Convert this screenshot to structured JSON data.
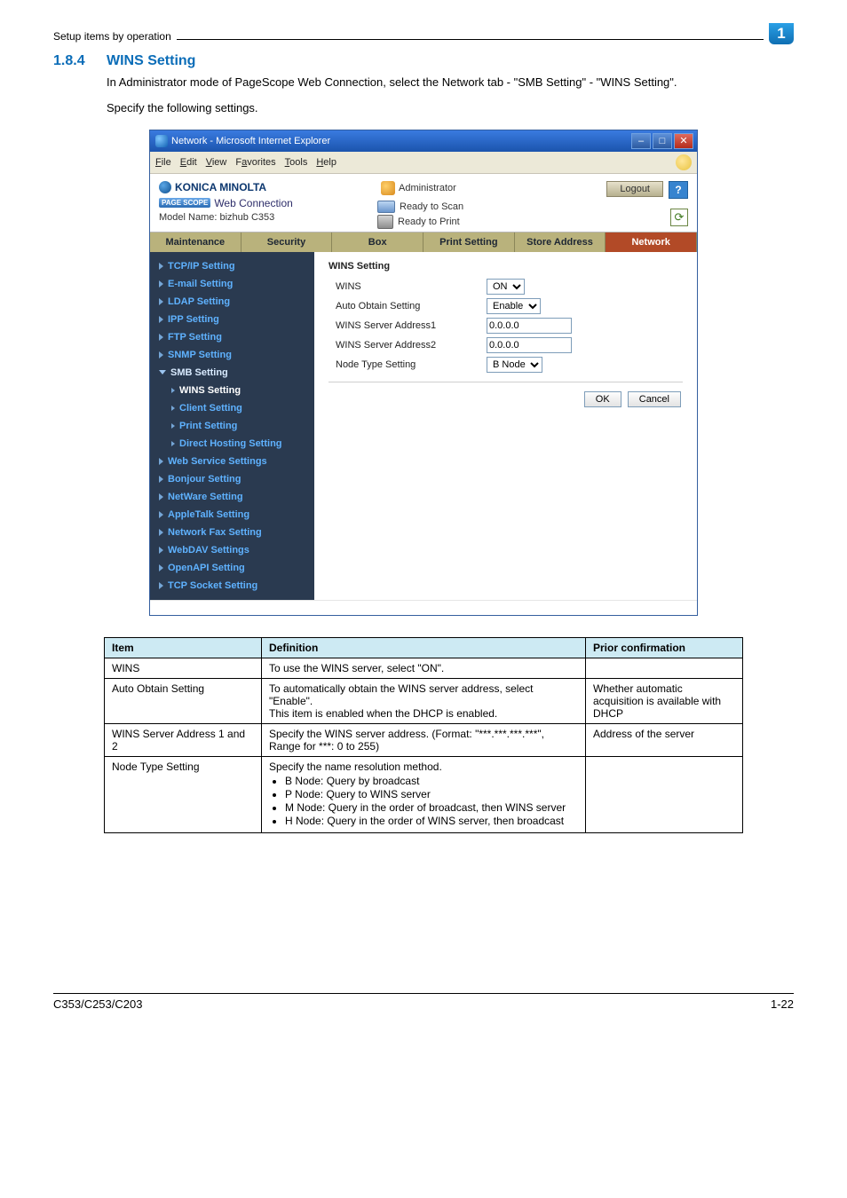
{
  "breadcrumb": "Setup items by operation",
  "top_badge": "1",
  "section": {
    "number": "1.8.4",
    "title": "WINS Setting",
    "desc1": "In Administrator mode of PageScope Web Connection, select the Network tab - \"SMB Setting\" - \"WINS Setting\".",
    "desc2": "Specify the following settings."
  },
  "ie": {
    "title": "Network - Microsoft Internet Explorer",
    "menu": {
      "file": "File",
      "edit": "Edit",
      "view": "View",
      "favorites": "Favorites",
      "tools": "Tools",
      "help": "Help"
    }
  },
  "ps_header": {
    "brand": "KONICA MINOLTA",
    "web_connection": "Web Connection",
    "page_scope": "PAGE SCOPE",
    "model": "Model Name: bizhub C353",
    "admin": "Administrator",
    "ready_scan": "Ready to Scan",
    "ready_print": "Ready to Print",
    "logout": "Logout",
    "help": "?"
  },
  "tabs": {
    "maintenance": "Maintenance",
    "security": "Security",
    "box": "Box",
    "print": "Print Setting",
    "store": "Store Address",
    "network": "Network"
  },
  "sidebar": {
    "tcpip": "TCP/IP Setting",
    "email": "E-mail Setting",
    "ldap": "LDAP Setting",
    "ipp": "IPP Setting",
    "ftp": "FTP Setting",
    "snmp": "SNMP Setting",
    "smb": "SMB Setting",
    "wins": "WINS Setting",
    "client": "Client Setting",
    "print_sub": "Print Setting",
    "direct": "Direct Hosting Setting",
    "web": "Web Service Settings",
    "bonjour": "Bonjour Setting",
    "netware": "NetWare Setting",
    "appletalk": "AppleTalk Setting",
    "netfax": "Network Fax Setting",
    "webdav": "WebDAV Settings",
    "openapi": "OpenAPI Setting",
    "tcpsocket": "TCP Socket Setting"
  },
  "panel": {
    "title": "WINS Setting",
    "row_wins": "WINS",
    "row_auto": "Auto Obtain Setting",
    "row_addr1": "WINS Server Address1",
    "row_addr2": "WINS Server Address2",
    "row_node": "Node Type Setting",
    "val_on": "ON",
    "val_enable": "Enable",
    "val_ip": "0.0.0.0",
    "val_bnode": "B Node",
    "ok": "OK",
    "cancel": "Cancel"
  },
  "table": {
    "h_item": "Item",
    "h_def": "Definition",
    "h_prior": "Prior confirmation",
    "r1_item": "WINS",
    "r1_def": "To use the WINS server, select \"ON\".",
    "r1_prior": "",
    "r2_item": "Auto Obtain Setting",
    "r2_def": "To automatically obtain the WINS server address, select \"Enable\".\nThis item is enabled when the DHCP is enabled.",
    "r2_prior": "Whether automatic acquisition is available with DHCP",
    "r3_item": "WINS Server Address 1 and 2",
    "r3_def": "Specify the WINS server address. (Format: \"***.***.***.***\", Range for ***: 0 to 255)",
    "r3_prior": "Address of the server",
    "r4_item": "Node Type Setting",
    "r4_def_lead": "Specify the name resolution method.",
    "r4_b1": "B Node: Query by broadcast",
    "r4_b2": "P Node: Query to WINS server",
    "r4_b3": "M Node: Query in the order of broadcast, then WINS server",
    "r4_b4": "H Node: Query in the order of WINS server, then broadcast",
    "r4_prior": ""
  },
  "footer": {
    "left": "C353/C253/C203",
    "right": "1-22"
  }
}
